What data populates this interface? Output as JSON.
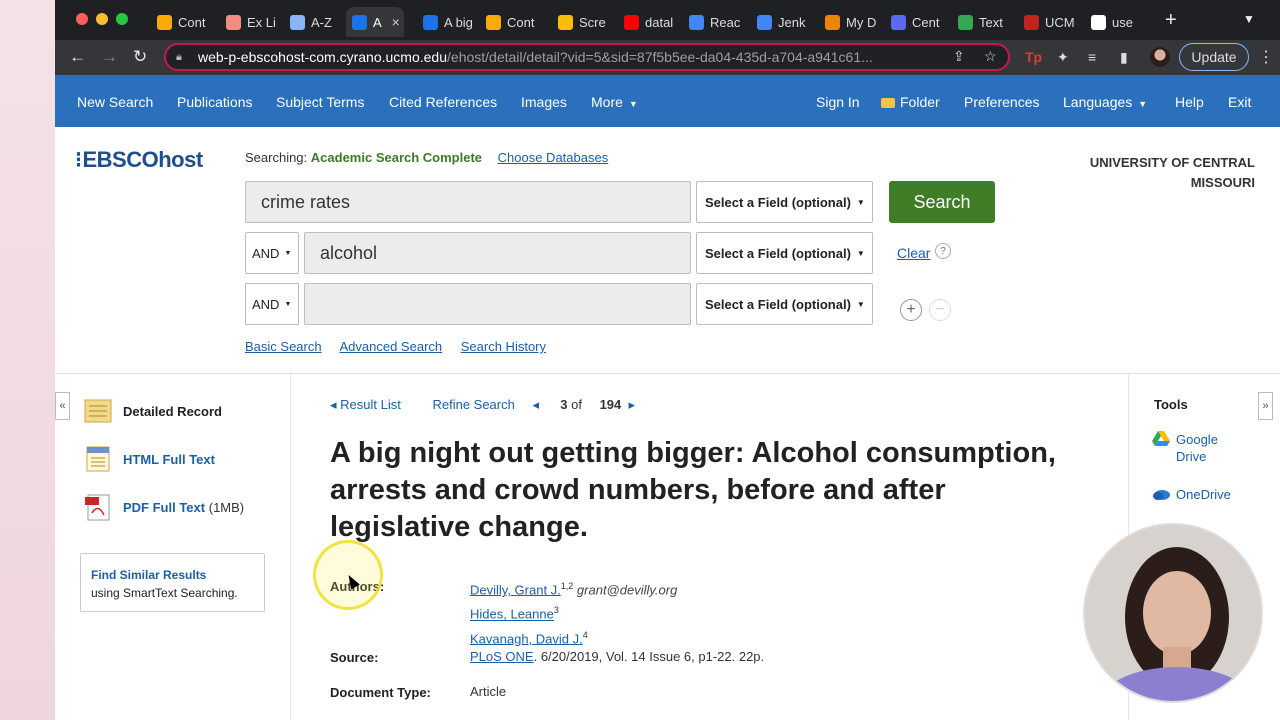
{
  "browser": {
    "tabs": [
      {
        "label": "Cont",
        "icon": "chart-icon",
        "color": "#f9ab00"
      },
      {
        "label": "Ex Li",
        "icon": "rainbow-icon",
        "color": "#f28b82"
      },
      {
        "label": "A-Z",
        "icon": "cloud-icon",
        "color": "#8ab4f8"
      },
      {
        "label": "A",
        "icon": "ebsco-e-icon",
        "color": "#1a73e8",
        "active": true
      },
      {
        "label": "A big",
        "icon": "ebsco-e-icon",
        "color": "#1a73e8"
      },
      {
        "label": "Cont",
        "icon": "chart-icon",
        "color": "#f9ab00"
      },
      {
        "label": "Scre",
        "icon": "slides-icon",
        "color": "#fbbc04"
      },
      {
        "label": "datal",
        "icon": "youtube-icon",
        "color": "#ff0000"
      },
      {
        "label": "Reac",
        "icon": "docs-icon",
        "color": "#4285f4"
      },
      {
        "label": "Jenk",
        "icon": "docs-icon",
        "color": "#4285f4"
      },
      {
        "label": "My D",
        "icon": "circle-icon",
        "color": "#ea8600"
      },
      {
        "label": "Cent",
        "icon": "clock-icon",
        "color": "#5b6bf0"
      },
      {
        "label": "Text",
        "icon": "green-icon",
        "color": "#34a853"
      },
      {
        "label": "UCM",
        "icon": "ucm-icon",
        "color": "#c5221f"
      },
      {
        "label": "use",
        "icon": "google-icon",
        "color": "#ffffff"
      }
    ],
    "url_host": "web-p-ebscohost-com.cyrano.ucmo.edu",
    "url_path": "/ehost/detail/detail?vid=5&sid=87f5b5ee-da04-435d-a704-a941c61...",
    "update_label": "Update"
  },
  "nav": {
    "left": [
      "New Search",
      "Publications",
      "Subject Terms",
      "Cited References",
      "Images",
      "More"
    ],
    "right": [
      "Sign In",
      "Folder",
      "Preferences",
      "Languages",
      "Help",
      "Exit"
    ]
  },
  "header": {
    "logo": "EBSCOhost",
    "searching_label": "Searching:",
    "database": "Academic Search Complete",
    "choose_db": "Choose Databases",
    "university": "UNIVERSITY OF CENTRAL MISSOURI"
  },
  "search": {
    "row1_value": "crime rates",
    "row2_bool": "AND",
    "row2_value": "alcohol",
    "row3_bool": "AND",
    "row3_value": "",
    "field_placeholder": "Select a Field (optional)",
    "search_button": "Search",
    "clear": "Clear",
    "help": "?",
    "links": [
      "Basic Search",
      "Advanced Search",
      "Search History"
    ]
  },
  "left_panel": {
    "detailed_record": "Detailed Record",
    "html_full_text": "HTML Full Text",
    "pdf_full_text": "PDF Full Text",
    "pdf_size": "(1MB)",
    "similar_title": "Find Similar Results",
    "similar_sub": "using SmartText Searching."
  },
  "record": {
    "result_list": "Result List",
    "refine": "Refine Search",
    "position": "3",
    "of": "of",
    "total": "194",
    "title": "A big night out getting bigger: Alcohol consumption, arrests and crowd numbers, before and after legislative change.",
    "authors_label": "Authors:",
    "authors": [
      {
        "name": "Devilly, Grant J.",
        "sup": "1,2",
        "email": "grant@devilly.org"
      },
      {
        "name": "Hides, Leanne",
        "sup": "3",
        "email": ""
      },
      {
        "name": "Kavanagh, David J.",
        "sup": "4",
        "email": ""
      }
    ],
    "source_label": "Source:",
    "source_journal": "PLoS ONE",
    "source_detail": ". 6/20/2019, Vol. 14 Issue 6, p1-22. 22p.",
    "doctype_label": "Document Type:",
    "doctype": "Article"
  },
  "tools": {
    "heading": "Tools",
    "google_drive": "Google Drive",
    "onedrive": "OneDrive"
  },
  "colors": {
    "ebsco_blue": "#2a70bd",
    "search_green": "#3f7d26",
    "link_blue": "#1a5fa8",
    "omnibox_border": "#c2185b"
  }
}
